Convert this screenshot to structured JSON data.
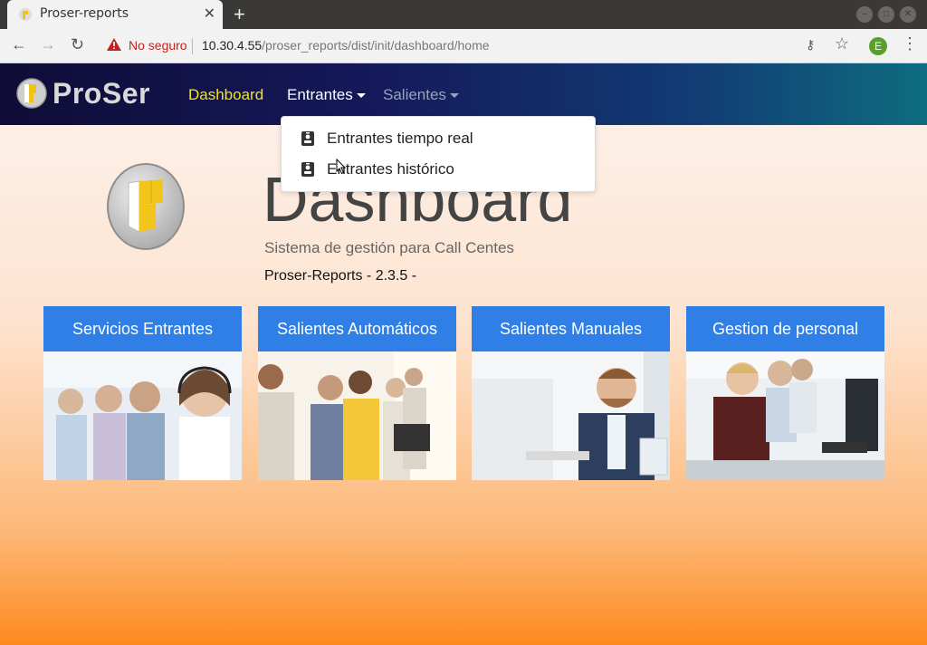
{
  "browser": {
    "tab_title": "Proser-reports",
    "tab_close": "✕",
    "new_tab": "+",
    "not_secure": "No seguro",
    "url_host": "10.30.4.55",
    "url_path": "/proser_reports/dist/init/dashboard/home",
    "avatar_letter": "E"
  },
  "navbar": {
    "brand": "ProSer",
    "links": [
      {
        "label": "Dashboard"
      },
      {
        "label": "Entrantes"
      },
      {
        "label": "Salientes"
      }
    ],
    "dropdown": [
      {
        "label": "Entrantes tiempo real"
      },
      {
        "label": "Entrantes histórico"
      }
    ]
  },
  "hero": {
    "title": "Dashboard",
    "subtitle": "Sistema de gestión para Call Centes",
    "version": "Proser-Reports - 2.3.5 -"
  },
  "cards": [
    {
      "title": "Servicios Entrantes"
    },
    {
      "title": "Salientes Automáticos"
    },
    {
      "title": "Salientes Manuales"
    },
    {
      "title": "Gestion de personal"
    }
  ],
  "colors": {
    "accent": "#2f7fe6",
    "active_nav": "#f4e31c",
    "warning": "#c5221f"
  }
}
